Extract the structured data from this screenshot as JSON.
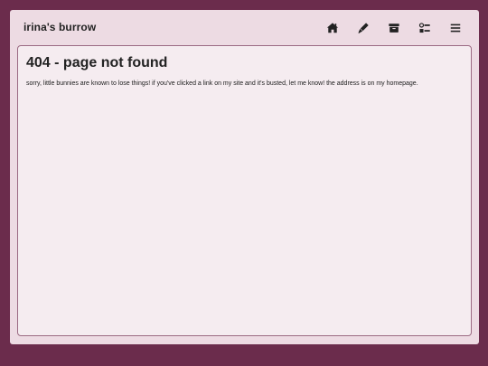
{
  "header": {
    "site_title": "irina's burrow",
    "nav": [
      {
        "icon": "home-icon"
      },
      {
        "icon": "pen-icon"
      },
      {
        "icon": "archive-icon"
      },
      {
        "icon": "list-checks-icon"
      },
      {
        "icon": "menu-icon"
      }
    ]
  },
  "main": {
    "title": "404 - page not found",
    "message": "sorry, little bunnies are known to lose things! if you've clicked a link on my site and it's busted, let me know! the address is on my homepage."
  },
  "colors": {
    "background": "#6b2c4c",
    "window": "#eddbe3",
    "panel": "#f5ecf0",
    "panel_border": "#9b6a83",
    "text": "#222222"
  }
}
